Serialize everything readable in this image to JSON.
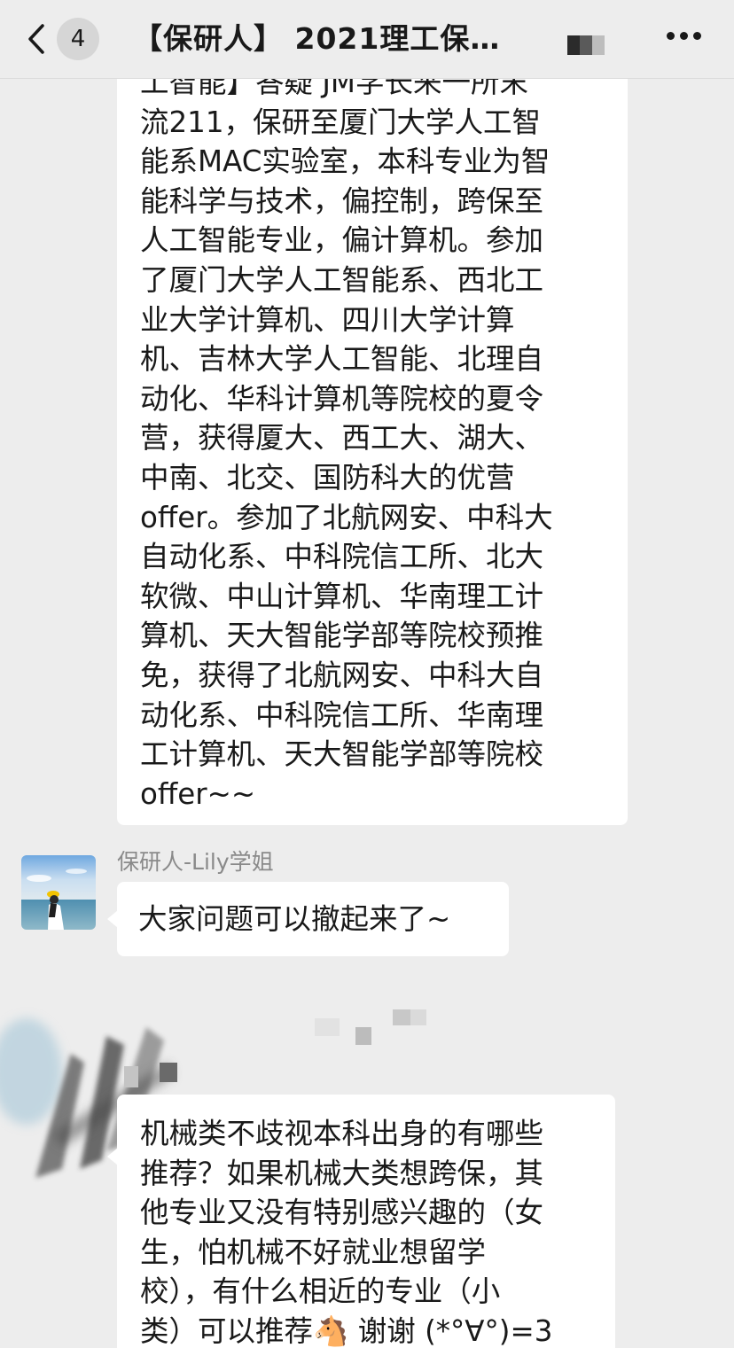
{
  "header": {
    "unread_count": "4",
    "title": "【保研人】 2021理工保研…",
    "back_icon": "chevron-left-icon",
    "more_icon": "ellipsis-icon"
  },
  "messages": [
    {
      "lines": [
        "工智能】答疑 JM学长来一所末",
        "流211，保研至厦门大学人工智",
        "能系MAC实验室，本科专业为智",
        "能科学与技术，偏控制，跨保至",
        "人工智能专业，偏计算机。参加",
        "了厦门大学人工智能系、西北工",
        "业大学计算机、四川大学计算",
        "机、吉林大学人工智能、北理自",
        "动化、华科计算机等院校的夏令",
        "营，获得厦大、西工大、湖大、",
        "中南、北交、国防科大的优营",
        "offer。参加了北航网安、中科大",
        "自动化系、中科院信工所、北大",
        "软微、中山计算机、华南理工计",
        "算机、天大智能学部等院校预推",
        "免，获得了北航网安、中科大自",
        "动化系、中科院信工所、华南理",
        "工计算机、天大智能学部等院校",
        "offer~~"
      ]
    },
    {
      "sender": "保研人-Lily学姐",
      "text": "大家问题可以撤起来了~"
    },
    {
      "lines": [
        "机械类不歧视本科出身的有哪些",
        "推荐？如果机械大类想跨保，其",
        "他专业又没有特别感兴趣的（女",
        "生，怕机械不好就业想留学",
        "校），有什么相近的专业（小",
        "类）可以推荐🐴 谢谢 (*°∀°)=3"
      ]
    }
  ]
}
